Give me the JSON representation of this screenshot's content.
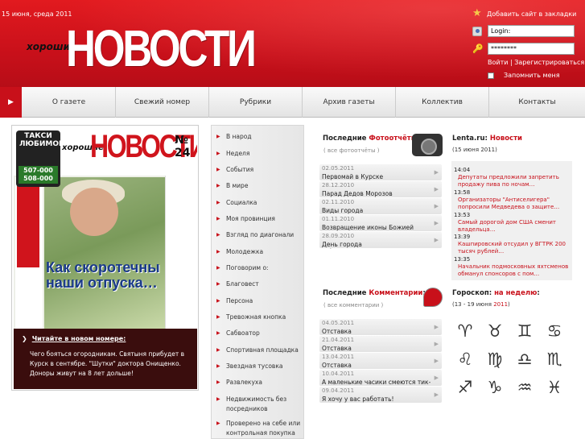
{
  "header": {
    "date": "15 июня, среда 2011",
    "logo_small": "хорошие",
    "logo_big": "НОВОСТИ",
    "bookmark_label": "Добавить сайт в закладки",
    "login_value": "Login:",
    "password_value": "********",
    "login_link": "Войти",
    "separator": " | ",
    "register_link": "Зарегистрироваться",
    "remember_label": "Запомнить меня"
  },
  "nav": {
    "items": [
      "О газете",
      "Свежий номер",
      "Рубрики",
      "Архив газеты",
      "Коллектив",
      "Контакты"
    ]
  },
  "newspaper": {
    "mast_small": "хорошие",
    "mast_title": "НОВОСТИ",
    "issue": "№ 24",
    "taxi_title": "ТАКСИ ЛЮБИМОЕ",
    "taxi_phone1": "507-000",
    "taxi_phone2": "508-000",
    "side_title": "НОВОСТИ",
    "headline": "Как скоротечны наши отпуска…",
    "read_title": "Читайте в новом номере:",
    "read_text": "Чего бояться огородникам. Святыня прибудет в Курск в сентябре. \"Шутки\" доктора Онищенко. Доноры живут на 8 лет дольше!"
  },
  "rubrics": [
    "В народ",
    "Неделя",
    "События",
    "В мире",
    "Социалка",
    "Моя провинция",
    "Взгляд по диагонали",
    "Молодежка",
    "Поговорим о:",
    "Благовест",
    "Персона",
    "Тревожная кнопка",
    "Сабвоатор",
    "Спортивная площадка",
    "Звездная тусовка",
    "Развлекуха",
    "Недвижимость без посредников",
    "Проверено на себе или контрольная покупка"
  ],
  "photos": {
    "title_prefix": "Последние ",
    "title_red": "Фотоотчёты",
    "title_suffix": ":",
    "all": "( все фотоотчёты )",
    "items": [
      {
        "date": "02.05.2011",
        "title": "Первомай в Курске"
      },
      {
        "date": "28.12.2010",
        "title": "Парад Дедов Морозов"
      },
      {
        "date": "02.11.2010",
        "title": "Виды города"
      },
      {
        "date": "01.11.2010",
        "title": "Возвращение иконы Божией Матери Знамение Курской-Коренной"
      },
      {
        "date": "28.09.2010",
        "title": "День города"
      }
    ]
  },
  "comments": {
    "title_prefix": "Последние ",
    "title_red": "Комментарии",
    "title_suffix": ":",
    "all": "( все комментарии )",
    "items": [
      {
        "date": "04.05.2011",
        "title": "Отставка"
      },
      {
        "date": "21.04.2011",
        "title": "Отставка"
      },
      {
        "date": "13.04.2011",
        "title": "Отставка"
      },
      {
        "date": "10.04.2011",
        "title": "А маленькие часики смеются тик-так…"
      },
      {
        "date": "09.04.2011",
        "title": "Я хочу у вас работать!"
      }
    ]
  },
  "lenta": {
    "title_prefix": "Lenta.ru: ",
    "title_red": "Новости",
    "subtitle": "(15 июня 2011)",
    "items": [
      {
        "time": "14:04",
        "text": "Депутаты предложили запретить продажу пива по ночам…"
      },
      {
        "time": "13:58",
        "text": "Организаторы \"Антиселигера\" попросили Медведева о защите…"
      },
      {
        "time": "13:53",
        "text": "Самый дорогой дом США сменит владельца…"
      },
      {
        "time": "13:39",
        "text": "Кашпировский отсудил у ВГТРК 200 тысяч рублей…"
      },
      {
        "time": "13:35",
        "text": "Начальник подмосковных яхтсменов обманул спонсоров с пом…"
      }
    ]
  },
  "horoscope": {
    "title_prefix": "Гороскоп: ",
    "title_red": "на неделю",
    "title_suffix": ":",
    "subtitle_prefix": "(13 - 19 июня ",
    "subtitle_year": "2011",
    "subtitle_suffix": ")",
    "signs": [
      "♈",
      "♉",
      "♊",
      "♋",
      "♌",
      "♍",
      "♎",
      "♏",
      "♐",
      "♑",
      "♒",
      "♓"
    ]
  }
}
